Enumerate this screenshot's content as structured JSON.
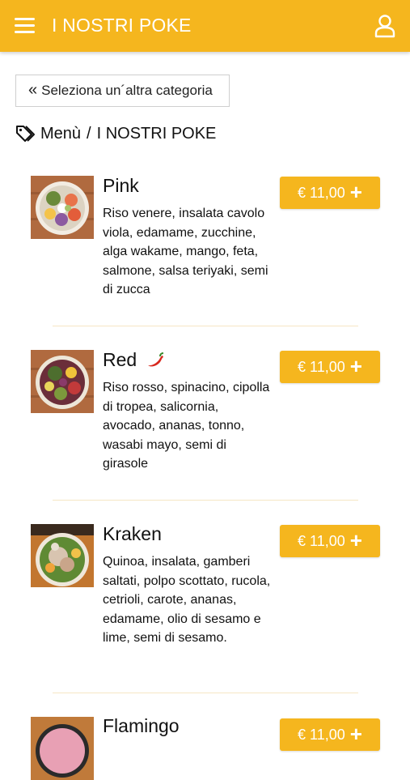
{
  "header": {
    "title": "I NOSTRI POKE"
  },
  "back_button": {
    "chevron": "«",
    "label": "Seleziona un´altra categoria"
  },
  "breadcrumb": {
    "root": "Menù",
    "separator": "/",
    "current": "I NOSTRI POKE"
  },
  "colors": {
    "accent": "#f5b61e"
  },
  "items": [
    {
      "name": "Pink",
      "price": "€ 11,00",
      "description": "Riso venere, insalata cavolo viola, edamame, zucchine, alga wakame, mango, feta, salmone, salsa teriyaki, semi di zucca"
    },
    {
      "name": "Red",
      "price": "€ 11,00",
      "description": "Riso rosso, spinacino, cipolla di tropea, salicornia, avocado, ananas, tonno, wasabi mayo, semi di girasole"
    },
    {
      "name": "Kraken",
      "price": "€ 11,00",
      "description": "Quinoa, insalata, gamberi saltati, polpo scottato, rucola, cetrioli, carote, ananas, edamame, olio di sesamo e lime, semi di sesamo."
    },
    {
      "name": "Flamingo",
      "price": "€ 11,00",
      "description": ""
    }
  ]
}
